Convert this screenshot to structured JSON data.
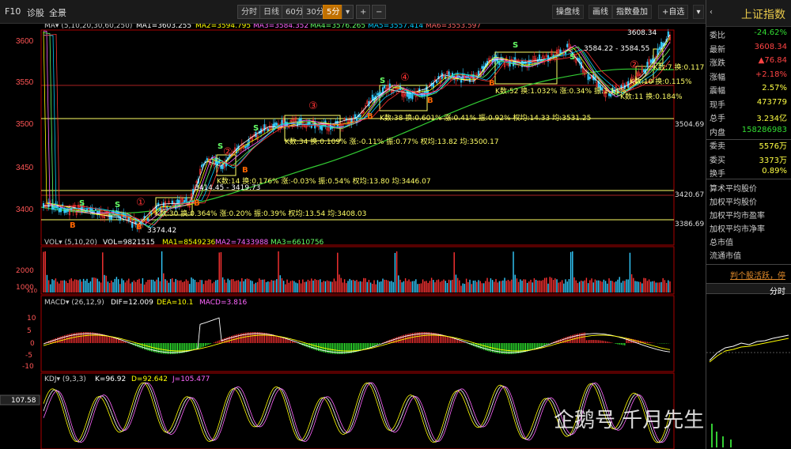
{
  "toolbar": {
    "f10": "F10",
    "diag": "诊股",
    "full": "全景",
    "periods": [
      "分时",
      "日线",
      "60分",
      "30分",
      "5分"
    ],
    "active_period": "5分",
    "plus": "+",
    "minus": "−",
    "right_buttons": [
      "操盘线",
      "画线",
      "指数叠加",
      "+自选"
    ]
  },
  "main_chart": {
    "indicator": "MA",
    "params": "(5,10,20,30,60,250)",
    "ma_values": [
      "MA1=3603.255",
      "MA2=3594.795",
      "MA3=3584.352",
      "MA4=3576.265",
      "MA5=3557.414",
      "MA6=3553.597"
    ],
    "ma_colors": [
      "#ffffff",
      "#ffff00",
      "#ff66ff",
      "#66ff66",
      "#00ccff",
      "#ff3333"
    ],
    "yticks": [
      "3600",
      "3550",
      "3500",
      "3450",
      "3400"
    ],
    "right_levels": [
      "3504.69",
      "3420.67",
      "3386.69"
    ],
    "annotations": [
      "3608.34",
      "3584.22 - 3584.55",
      "3414.45 - 3419.73",
      "3374.42",
      "K数:30 换:0.364% 涨:0.20% 振:0.39% 权均:13.54 均:3408.03",
      "K数:14 换:0.176% 涨:-0.03% 振:0.54% 权均:13.80 均:3446.07",
      "K数:34 换:0.109% 涨:-0.11% 振:0.77% 权均:13.82 均:3500.17",
      "K数:38 换:0.601% 涨:0.41% 振:0.92% 权均:14.33 均:3531.25",
      "K数:52 换:1.032% 涨:0.34% 振:1.14%",
      "K数:7 换:0.117",
      "K数:10 换:0.115%",
      "K数:11 换:0.184%"
    ],
    "circles": [
      "①",
      "②",
      "③",
      "④",
      "②"
    ]
  },
  "vol_panel": {
    "label": "VOL",
    "params": "(5,10,20)",
    "values": [
      "VOL=9821515",
      "MA1=8549236",
      "MA2=7433988",
      "MA3=6610756"
    ],
    "yticks": [
      "2000",
      "1000"
    ],
    "unit": "x10"
  },
  "macd_panel": {
    "label": "MACD",
    "params": "(26,12,9)",
    "values": [
      "DIF=12.009",
      "DEA=10.1",
      "MACD=3.816"
    ],
    "yticks": [
      "10",
      "5",
      "0",
      "-5",
      "-10"
    ]
  },
  "kdj_panel": {
    "label": "KDJ",
    "params": "(9,3,3)",
    "values": [
      "K=96.92",
      "D=92.642",
      "J=105.477"
    ],
    "current": "107.58"
  },
  "sidebar": {
    "title": "上证指数",
    "rows": [
      {
        "k": "委比",
        "v": "-24.62%",
        "c": "#33dd33"
      },
      {
        "k": "最新",
        "v": "3608.34",
        "c": "#ff4444"
      },
      {
        "k": "涨跌",
        "v": "▲76.84",
        "c": "#ff4444"
      },
      {
        "k": "涨幅",
        "v": "+2.18%",
        "c": "#ff4444"
      },
      {
        "k": "震幅",
        "v": "2.57%",
        "c": "#ffff44"
      },
      {
        "k": "现手",
        "v": "473779",
        "c": "#ffff44"
      },
      {
        "k": "总手",
        "v": "3.234亿",
        "c": "#ffff44"
      },
      {
        "k": "内盘",
        "v": "158286983",
        "c": "#33dd33"
      },
      {
        "k": "委卖",
        "v": "5576万",
        "c": "#ffff44"
      },
      {
        "k": "委买",
        "v": "3373万",
        "c": "#ffff44"
      },
      {
        "k": "换手",
        "v": "0.89%",
        "c": "#ffff44"
      }
    ],
    "links": [
      "算术平均股价",
      "加权平均股价",
      "加权平均市盈率",
      "加权平均市净率",
      "总市值",
      "流通市值"
    ],
    "ticker": "判个股活跃，停",
    "tab": "分时"
  },
  "watermark": "企鹅号 千月先生"
}
